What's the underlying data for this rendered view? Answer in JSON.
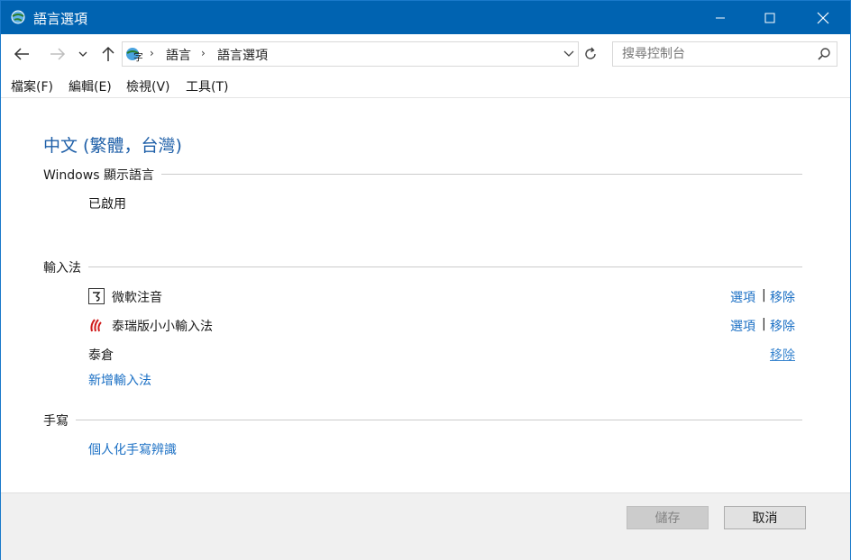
{
  "window": {
    "title": "語言選項",
    "icon": "language-globe-icon"
  },
  "nav": {
    "breadcrumb": [
      "語言",
      "語言選項"
    ],
    "search_placeholder": "搜尋控制台"
  },
  "menu": [
    "檔案(F)",
    "編輯(E)",
    "檢視(V)",
    "工具(T)"
  ],
  "content": {
    "language_title": "中文 (繁體，台灣)",
    "sections": {
      "display_language": {
        "header": "Windows 顯示語言",
        "status": "已啟用"
      },
      "input_methods": {
        "header": "輸入法",
        "items": [
          {
            "name": "微軟注音",
            "icon": "bopomofo-ime-icon",
            "options_label": "選項",
            "remove_label": "移除"
          },
          {
            "name": "泰瑞版小小輸入法",
            "icon": "xiaoxiao-ime-icon",
            "options_label": "選項",
            "remove_label": "移除"
          },
          {
            "name": "泰倉",
            "remove_label": "移除"
          }
        ],
        "add_label": "新增輸入法"
      },
      "handwriting": {
        "header": "手寫",
        "link": "個人化手寫辨識"
      }
    }
  },
  "footer": {
    "save_label": "儲存",
    "cancel_label": "取消"
  },
  "colors": {
    "titlebar": "#0063b1",
    "link": "#1a6fc4",
    "heading": "#1e5fa8"
  }
}
